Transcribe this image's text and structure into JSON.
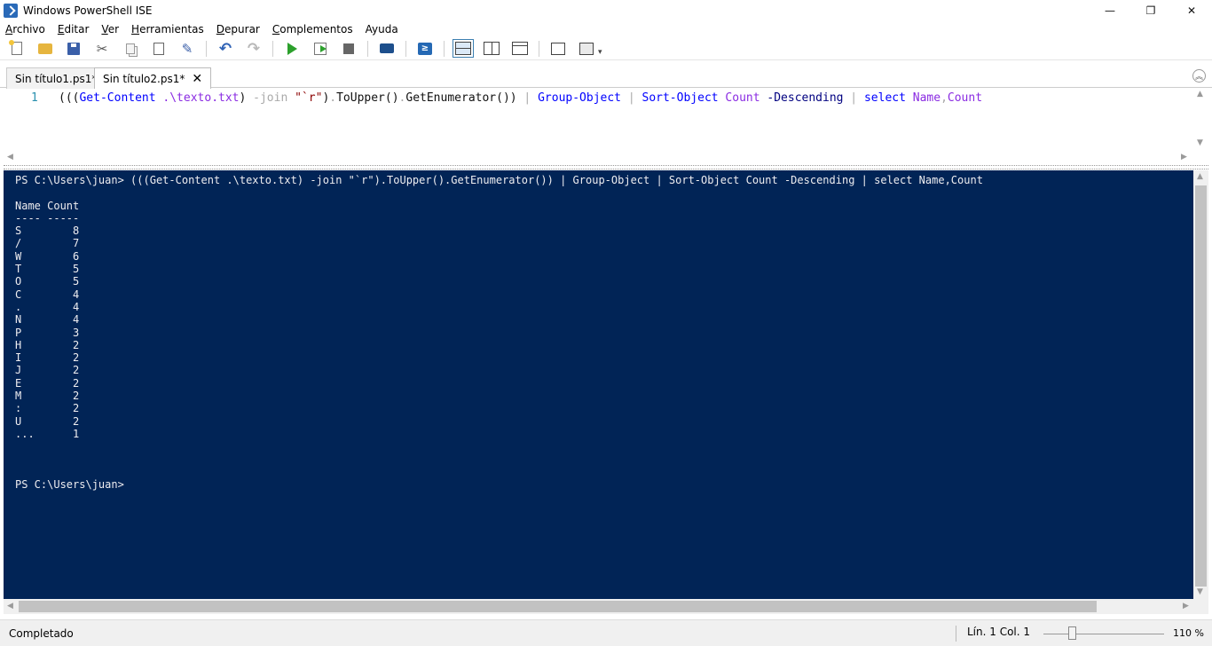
{
  "window": {
    "title": "Windows PowerShell ISE",
    "minimize": "—",
    "maximize": "❐",
    "close": "✕"
  },
  "menu": [
    {
      "key": "A",
      "rest": "rchivo"
    },
    {
      "key": "E",
      "rest": "ditar"
    },
    {
      "key": "V",
      "rest": "er"
    },
    {
      "key": "H",
      "rest": "erramientas"
    },
    {
      "key": "D",
      "rest": "epurar"
    },
    {
      "key": "C",
      "rest": "omplementos"
    },
    {
      "key": "A",
      "rest": "yuda",
      "ukey": "y"
    }
  ],
  "toolbar": {
    "icons": [
      "new-script-icon",
      "open-icon",
      "save-icon",
      "cut-icon",
      "copy-icon",
      "paste-icon",
      "clear-console-icon",
      "undo-icon",
      "redo-icon",
      "run-script-icon",
      "run-selection-icon",
      "stop-icon",
      "remote-powershell-icon",
      "powershell-console-icon",
      "layout-top-icon",
      "layout-right-icon",
      "layout-maximized-icon",
      "show-commands-icon",
      "show-addon-icon"
    ],
    "cut_glyph": "✂",
    "clear_glyph": "✎",
    "undo_glyph": "↶",
    "redo_glyph": "↷",
    "ps_glyph": "≥",
    "more_glyph": "▾"
  },
  "tabs": [
    {
      "label": "Sin título1.ps1*",
      "active": false
    },
    {
      "label": "Sin título2.ps1*",
      "active": true,
      "close": "✕"
    }
  ],
  "collapse_glyph": "︽",
  "editor": {
    "line_number": "1",
    "tokens": [
      {
        "text": "(((",
        "cls": "c-dark"
      },
      {
        "text": "Get-Content",
        "cls": "c-cmd"
      },
      {
        "text": " ",
        "cls": "c-dark"
      },
      {
        "text": ".\\texto.txt",
        "cls": "c-arg"
      },
      {
        "text": ") ",
        "cls": "c-dark"
      },
      {
        "text": "-join",
        "cls": "c-gray"
      },
      {
        "text": " ",
        "cls": "c-dark"
      },
      {
        "text": "\"`r\"",
        "cls": "c-str"
      },
      {
        "text": ")",
        "cls": "c-dark"
      },
      {
        "text": ".",
        "cls": "c-gray"
      },
      {
        "text": "ToUpper",
        "cls": "c-dark"
      },
      {
        "text": "()",
        "cls": "c-dark"
      },
      {
        "text": ".",
        "cls": "c-gray"
      },
      {
        "text": "GetEnumerator",
        "cls": "c-dark"
      },
      {
        "text": "())",
        "cls": "c-dark"
      },
      {
        "text": " | ",
        "cls": "c-gray"
      },
      {
        "text": "Group-Object",
        "cls": "c-cmd"
      },
      {
        "text": " | ",
        "cls": "c-gray"
      },
      {
        "text": "Sort-Object",
        "cls": "c-cmd"
      },
      {
        "text": " ",
        "cls": "c-dark"
      },
      {
        "text": "Count",
        "cls": "c-arg"
      },
      {
        "text": " ",
        "cls": "c-dark"
      },
      {
        "text": "-Descending",
        "cls": "c-param"
      },
      {
        "text": " | ",
        "cls": "c-gray"
      },
      {
        "text": "select",
        "cls": "c-cmd"
      },
      {
        "text": " ",
        "cls": "c-dark"
      },
      {
        "text": "Name",
        "cls": "c-arg"
      },
      {
        "text": ",",
        "cls": "c-gray"
      },
      {
        "text": "Count",
        "cls": "c-arg"
      }
    ]
  },
  "console": {
    "prompt": "PS C:\\Users\\juan>",
    "command": "(((Get-Content .\\texto.txt) -join \"`r\").ToUpper().GetEnumerator()) | Group-Object | Sort-Object Count -Descending | select Name,Count",
    "headers": [
      "Name",
      "Count"
    ],
    "underline": [
      "----",
      "-----"
    ],
    "rows": [
      [
        "S",
        "8"
      ],
      [
        "/",
        "7"
      ],
      [
        "W",
        "6"
      ],
      [
        "T",
        "5"
      ],
      [
        "O",
        "5"
      ],
      [
        "C",
        "4"
      ],
      [
        ".",
        "4"
      ],
      [
        "N",
        "4"
      ],
      [
        "P",
        "3"
      ],
      [
        "H",
        "2"
      ],
      [
        "I",
        "2"
      ],
      [
        "J",
        "2"
      ],
      [
        "E",
        "2"
      ],
      [
        "M",
        "2"
      ],
      [
        ":",
        "2"
      ],
      [
        "U",
        "2"
      ],
      [
        "...",
        "1"
      ]
    ],
    "final_prompt": "PS C:\\Users\\juan>"
  },
  "status": {
    "text": "Completado",
    "position": "Lín. 1  Col. 1",
    "zoom": "110 %",
    "zoom_percent": 110
  }
}
